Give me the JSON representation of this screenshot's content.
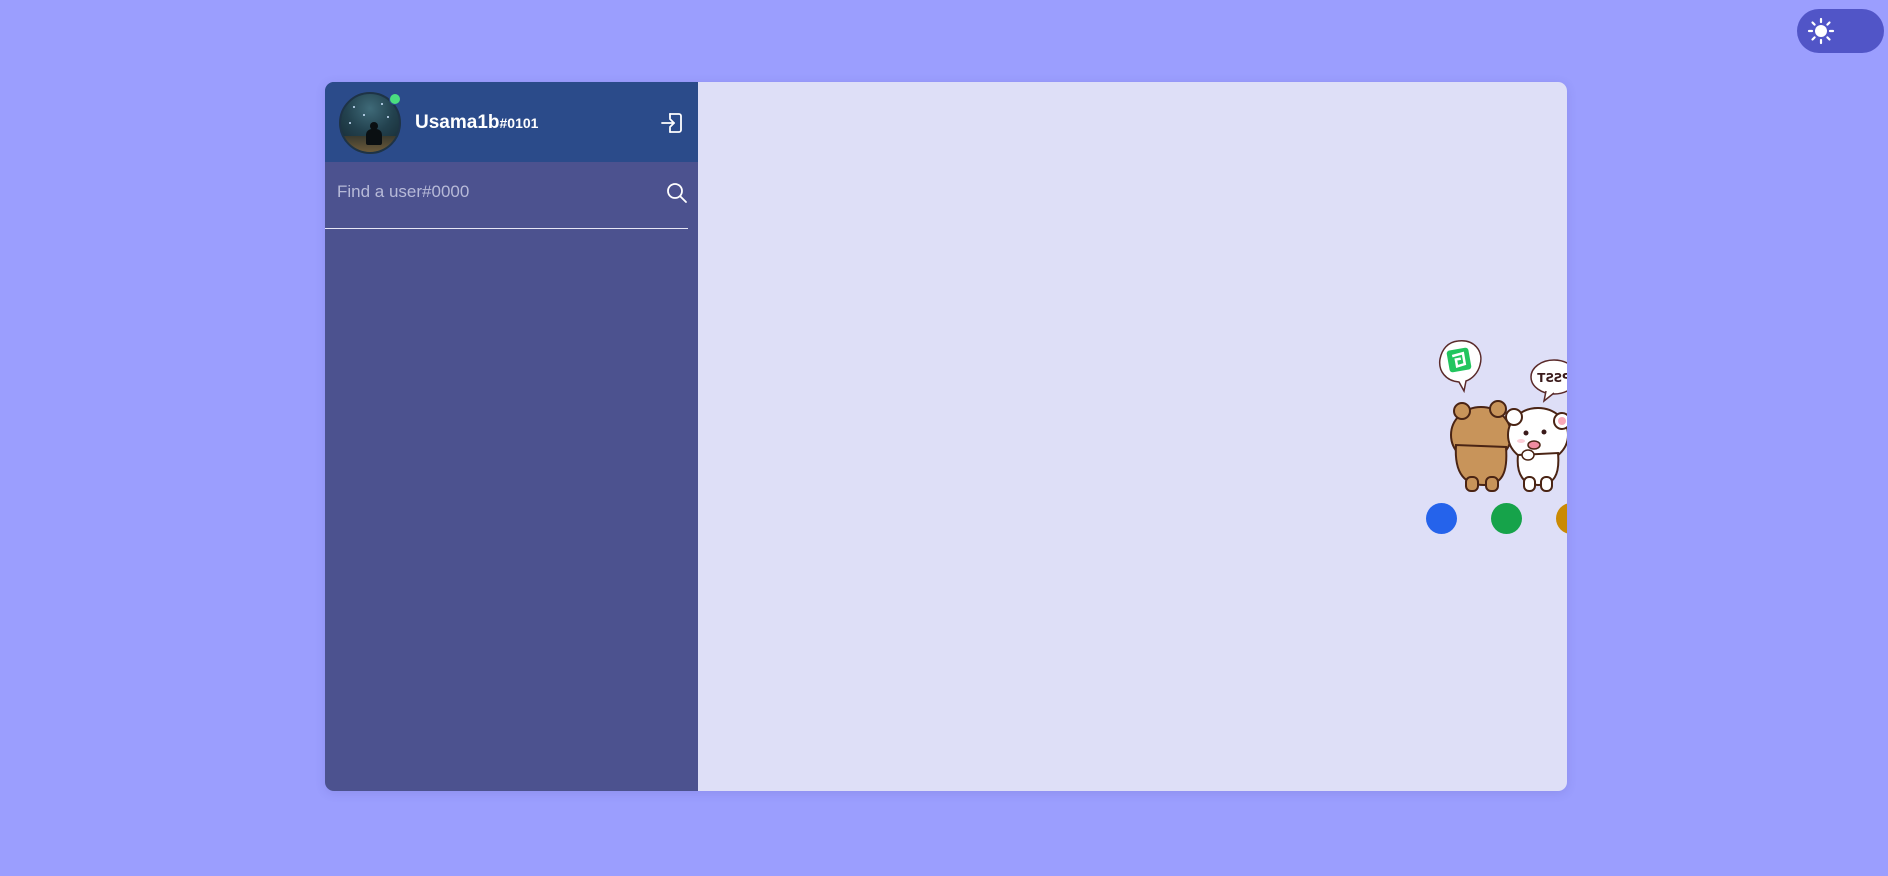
{
  "theme_toggle": {
    "icon": "sun-icon",
    "mode": "light"
  },
  "profile": {
    "name": "Usama1b",
    "tag": "#0101",
    "status": "online",
    "status_color": "#4ade80"
  },
  "search": {
    "placeholder": "Find a user#0000",
    "value": ""
  },
  "sticker": {
    "speech_bubble_text": "PSST"
  },
  "loading_dots": [
    {
      "color": "#2563eb"
    },
    {
      "color": "#16a34a"
    },
    {
      "color": "#ca8a04"
    }
  ],
  "colors": {
    "background": "#9b9efe",
    "sidebar": "#4c528f",
    "profile_bar": "#2b4b8a",
    "main_panel": "#dedff7",
    "toggle": "#5155c7"
  }
}
